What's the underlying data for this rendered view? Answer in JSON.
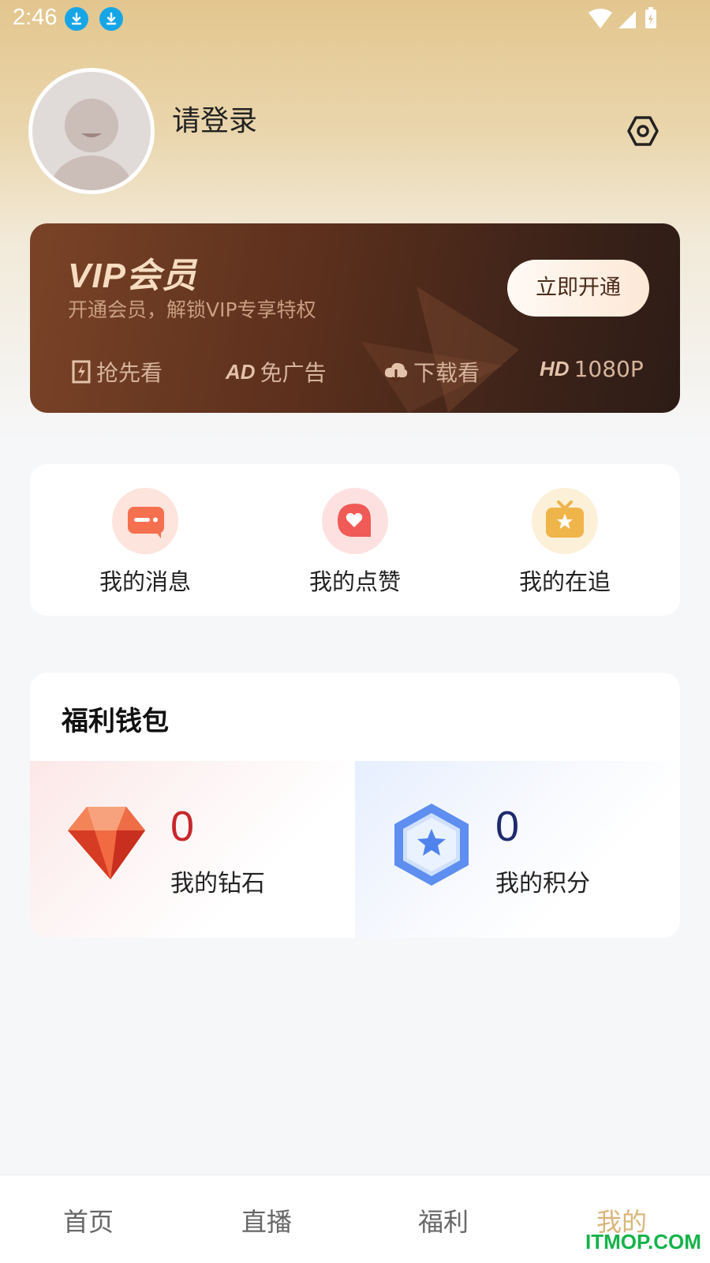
{
  "status_bar": {
    "time": "2:46"
  },
  "profile": {
    "login_text": "请登录"
  },
  "vip": {
    "title": "VIP会员",
    "subtitle": "开通会员，解锁VIP专享特权",
    "button": "立即开通",
    "features": [
      {
        "badge": "",
        "label": "抢先看",
        "icon": "lightning-icon"
      },
      {
        "badge": "AD",
        "label": "免广告",
        "icon": "ad-icon"
      },
      {
        "badge": "",
        "label": "下载看",
        "icon": "cloud-download-icon"
      },
      {
        "badge": "HD",
        "label": "1080P",
        "icon": "hd-icon"
      }
    ]
  },
  "quick_actions": [
    {
      "label": "我的消息",
      "icon": "message-icon",
      "color": "#f47a5c"
    },
    {
      "label": "我的点赞",
      "icon": "heart-icon",
      "color": "#f05d5d"
    },
    {
      "label": "我的在追",
      "icon": "tv-star-icon",
      "color": "#f0b54a"
    }
  ],
  "wallet": {
    "title": "福利钱包",
    "items": [
      {
        "value": "0",
        "label": "我的钻石",
        "icon": "diamond-icon",
        "value_color": "#c8262b"
      },
      {
        "value": "0",
        "label": "我的积分",
        "icon": "hexagon-star-icon",
        "value_color": "#1f2b6e"
      }
    ]
  },
  "bottom_nav": {
    "items": [
      {
        "label": "首页"
      },
      {
        "label": "直播"
      },
      {
        "label": "福利"
      },
      {
        "label": "我的",
        "active": true
      }
    ]
  },
  "watermark": "ITMOP.COM",
  "colors": {
    "accent_gold": "#d9b57a",
    "vip_dark": "#3b2219"
  }
}
